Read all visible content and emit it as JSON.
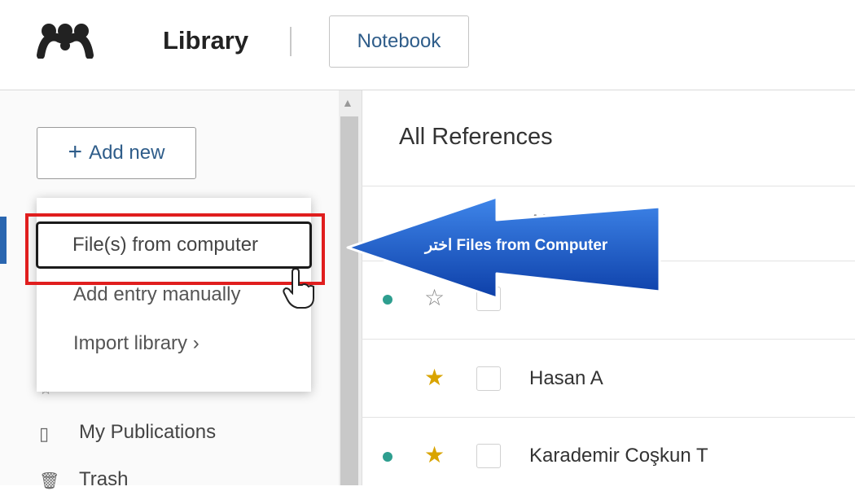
{
  "header": {
    "logo_icon": "mendeley-logo-icon",
    "title": "Library",
    "notebook_label": "Notebook"
  },
  "sidebar": {
    "add_new_label": "Add new",
    "add_new_icon": "plus-icon",
    "menu": [
      {
        "label": "File(s) from computer"
      },
      {
        "label": "Add entry manually"
      },
      {
        "label": "Import library ›"
      }
    ],
    "items": [
      {
        "label": "My Publications",
        "icon": "publications-icon"
      },
      {
        "label": "Trash",
        "icon": "trash-icon"
      }
    ]
  },
  "main": {
    "title": "All References",
    "column_header": "AUTH",
    "rows": [
      {
        "author": "",
        "unread": true,
        "starred": false
      },
      {
        "author": "Hasan A",
        "unread": false,
        "starred": true
      },
      {
        "author": "Karademir Coşkun T",
        "unread": true,
        "starred": true
      }
    ]
  },
  "callout": {
    "text": "اختر Files from Computer"
  },
  "colors": {
    "accent": "#2a66b0",
    "highlight": "#e01e1e",
    "unread_dot": "#2e9e8f",
    "star": "#d9a400",
    "callout_fill": "#1457c8"
  }
}
